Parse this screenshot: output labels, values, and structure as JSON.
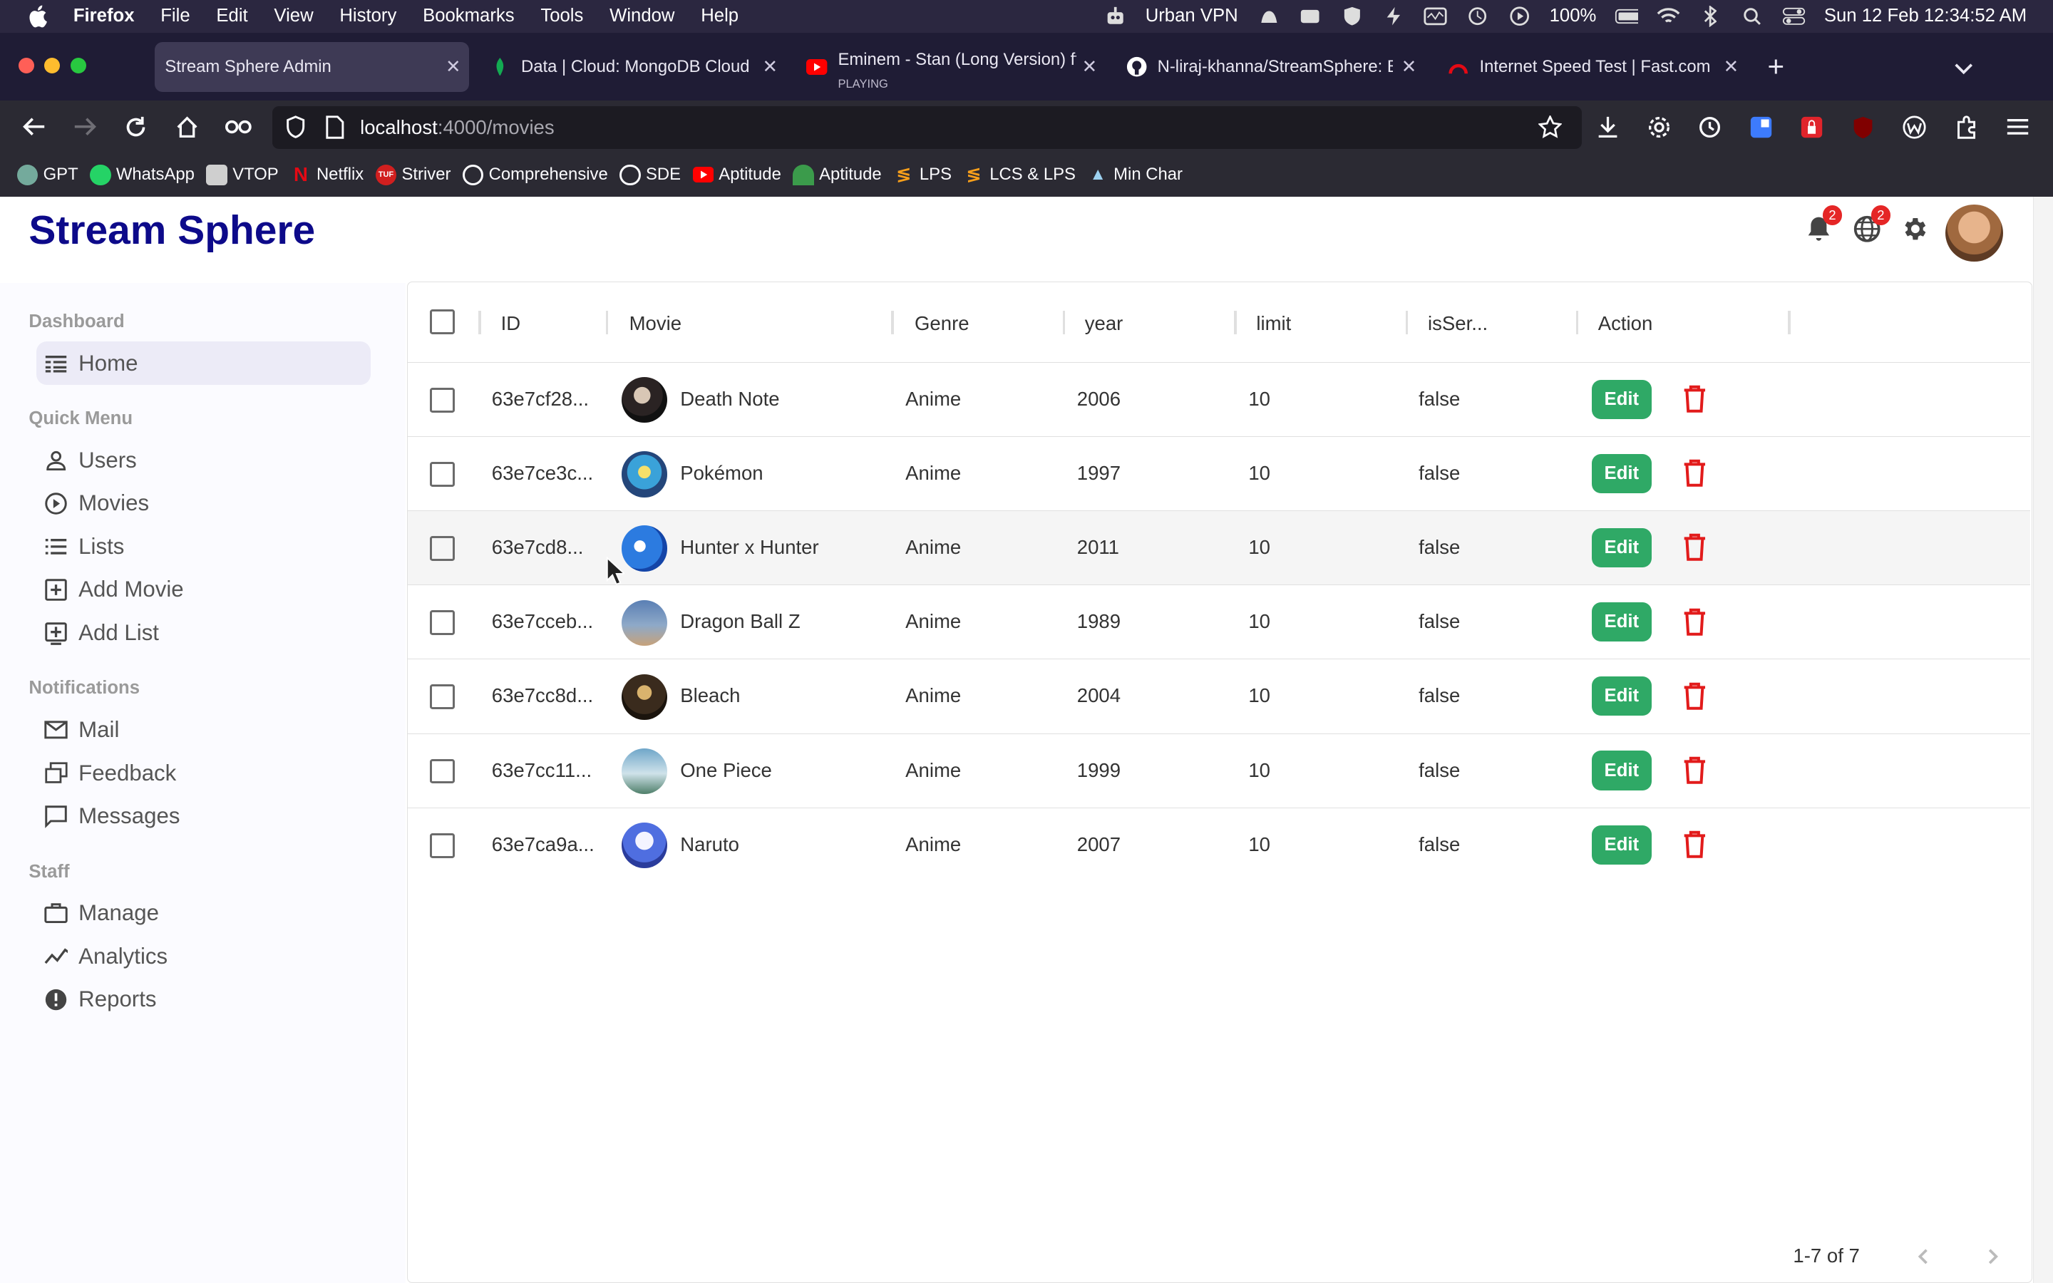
{
  "menubar": {
    "app": "Firefox",
    "menus": [
      "File",
      "Edit",
      "View",
      "History",
      "Bookmarks",
      "Tools",
      "Window",
      "Help"
    ],
    "vpn": "Urban VPN",
    "battery": "100%",
    "datetime": "Sun 12 Feb  12:34:52 AM"
  },
  "tabs": [
    {
      "title": "Stream Sphere Admin",
      "active": true
    },
    {
      "title": "Data | Cloud: MongoDB Cloud"
    },
    {
      "title": "Eminem - Stan (Long Version) ft",
      "sub": "PLAYING"
    },
    {
      "title": "N-liraj-khanna/StreamSphere: B"
    },
    {
      "title": "Internet Speed Test | Fast.com"
    }
  ],
  "url": {
    "host": "localhost",
    "path": ":4000/movies"
  },
  "bookmarks": [
    "GPT",
    "WhatsApp",
    "VTOP",
    "Netflix",
    "Striver",
    "Comprehensive",
    "SDE",
    "Aptitude",
    "Aptitude",
    "LPS",
    "LCS & LPS",
    "Min Char"
  ],
  "app": {
    "brand": "Stream Sphere",
    "badges": {
      "notifications": "2",
      "language": "2"
    }
  },
  "sidebar": {
    "sections": [
      {
        "title": "Dashboard",
        "items": [
          {
            "label": "Home",
            "icon": "dashboard-icon",
            "active": true
          }
        ]
      },
      {
        "title": "Quick Menu",
        "items": [
          {
            "label": "Users",
            "icon": "user-icon"
          },
          {
            "label": "Movies",
            "icon": "play-icon"
          },
          {
            "label": "Lists",
            "icon": "list-icon"
          },
          {
            "label": "Add Movie",
            "icon": "add-box-icon"
          },
          {
            "label": "Add List",
            "icon": "add-list-icon"
          }
        ]
      },
      {
        "title": "Notifications",
        "items": [
          {
            "label": "Mail",
            "icon": "mail-icon"
          },
          {
            "label": "Feedback",
            "icon": "feedback-icon"
          },
          {
            "label": "Messages",
            "icon": "message-icon"
          }
        ]
      },
      {
        "title": "Staff",
        "items": [
          {
            "label": "Manage",
            "icon": "briefcase-icon"
          },
          {
            "label": "Analytics",
            "icon": "timeline-icon"
          },
          {
            "label": "Reports",
            "icon": "report-icon"
          }
        ]
      }
    ]
  },
  "table": {
    "columns": [
      "ID",
      "Movie",
      "Genre",
      "year",
      "limit",
      "isSer...",
      "Action"
    ],
    "edit_label": "Edit",
    "rows": [
      {
        "id": "63e7cf28...",
        "movie": "Death Note",
        "genre": "Anime",
        "year": "2006",
        "limit": "10",
        "isSeries": "false"
      },
      {
        "id": "63e7ce3c...",
        "movie": "Pokémon",
        "genre": "Anime",
        "year": "1997",
        "limit": "10",
        "isSeries": "false"
      },
      {
        "id": "63e7cd8...",
        "movie": "Hunter x Hunter",
        "genre": "Anime",
        "year": "2011",
        "limit": "10",
        "isSeries": "false"
      },
      {
        "id": "63e7cceb...",
        "movie": "Dragon Ball Z",
        "genre": "Anime",
        "year": "1989",
        "limit": "10",
        "isSeries": "false"
      },
      {
        "id": "63e7cc8d...",
        "movie": "Bleach",
        "genre": "Anime",
        "year": "2004",
        "limit": "10",
        "isSeries": "false"
      },
      {
        "id": "63e7cc11...",
        "movie": "One Piece",
        "genre": "Anime",
        "year": "1999",
        "limit": "10",
        "isSeries": "false"
      },
      {
        "id": "63e7ca9a...",
        "movie": "Naruto",
        "genre": "Anime",
        "year": "2007",
        "limit": "10",
        "isSeries": "false"
      }
    ],
    "pagination": "1-7 of 7"
  },
  "colors": {
    "brand": "#0d0a8a",
    "edit": "#2fa966",
    "delete": "#e21b1b",
    "badge": "#e52626"
  }
}
